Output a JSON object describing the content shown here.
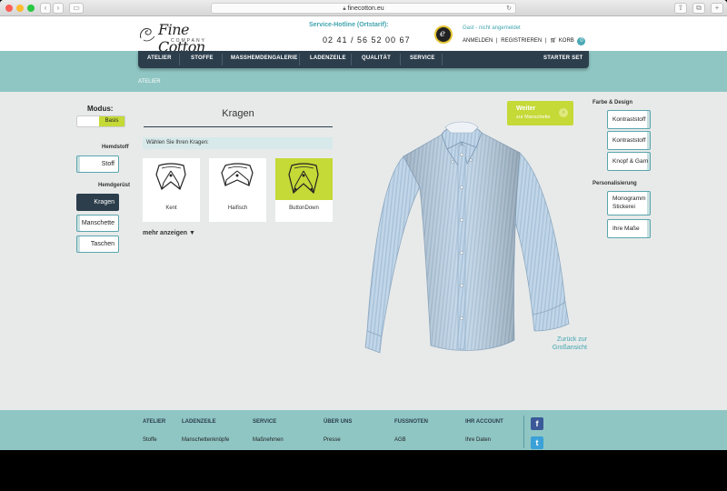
{
  "browser": {
    "url": "finecotton.eu"
  },
  "header": {
    "logo_script": "Fine Cotton",
    "logo_sub": "COMPANY",
    "hotline": "Service-Hotline (Ortstarif):",
    "phone": "02 41 / 56 52 00 67",
    "guest": "Gast - nicht angemeldet",
    "anmelden": "ANMELDEN",
    "registrieren": "REGISTRIEREN",
    "sep": "|",
    "korb": "KORB",
    "cart_count": "0"
  },
  "nav": {
    "items": [
      "ATELIER",
      "STOFFE",
      "MASSHEMDENGALERIE",
      "LADENZEILE",
      "QUALITÄT",
      "SERVICE"
    ],
    "starter": "STARTER SET"
  },
  "breadcrumb": "ATELIER",
  "modus": {
    "label": "Modus:",
    "value": "Basis"
  },
  "left_sidebar": {
    "hemdstoff_label": "Hemdstoff",
    "stoff": "Stoff",
    "hemdgeruest_label": "Hemdgerüst",
    "kragen": "Kragen",
    "manschette": "Manschette",
    "taschen": "Taschen"
  },
  "main": {
    "title": "Kragen",
    "choose": "Wählen Sie Ihren Kragen:",
    "collars": [
      "Kent",
      "Haifisch",
      "ButtonDown"
    ],
    "more": "mehr anzeigen ▼"
  },
  "weiter": {
    "title": "Weiter",
    "sub": "zur Manschette",
    "arrow": "›"
  },
  "zurueck": {
    "line1": "Zurück zur",
    "line2": "Großansicht"
  },
  "right_sidebar": {
    "farbe_label": "Farbe & Design",
    "kontraststoff1": "Kontraststoff",
    "kontraststoff2": "Kontraststoff",
    "knopf": "Knopf & Garn",
    "personalisierung_label": "Personalisierung",
    "monogramm_1": "Monogramm",
    "monogramm_2": "Stickerei",
    "masse": "Ihre Maße"
  },
  "footer": {
    "cols": [
      {
        "head": "ATELIER",
        "link": "Stoffe"
      },
      {
        "head": "LADENZEILE",
        "link": "Manschettenknöpfe"
      },
      {
        "head": "SERVICE",
        "link": "Maßnehmen"
      },
      {
        "head": "ÜBER UNS",
        "link": "Presse"
      },
      {
        "head": "FUSSNOTEN",
        "link": "AGB"
      },
      {
        "head": "IHR ACCOUNT",
        "link": "Ihre Daten"
      }
    ],
    "fb": "f",
    "tw": "t"
  },
  "colors": {
    "teal": "#8fc6c4",
    "navy": "#2c3e4c",
    "lime": "#c5d937",
    "accent": "#41a5ae"
  }
}
